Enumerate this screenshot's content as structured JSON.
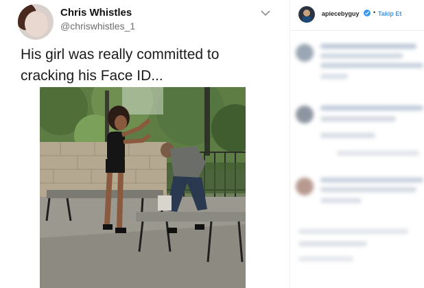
{
  "tweet": {
    "author_name": "Chris Whistles",
    "author_handle": "@chriswhistles_1",
    "text_line1": "His girl was really committed to",
    "text_line2": "cracking his Face ID...",
    "menu_icon": "chevron-down-icon"
  },
  "instagram": {
    "username": "apiecebyguy",
    "separator": "•",
    "follow_label": "Takip Et",
    "verified_icon": "verified-badge-icon",
    "accent_color": "#3897f0"
  }
}
